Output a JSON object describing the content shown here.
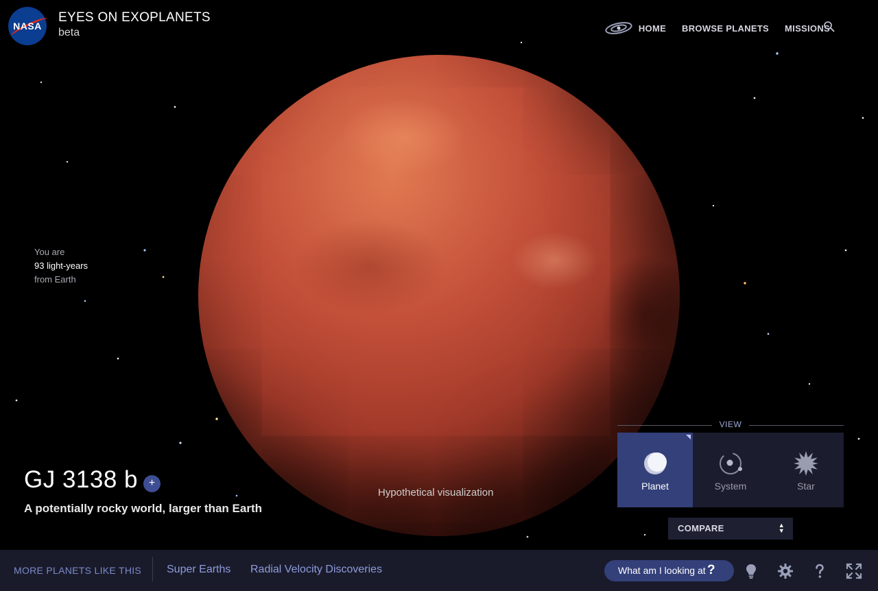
{
  "header": {
    "logo_text": "NASA",
    "title": "EYES ON EXOPLANETS",
    "subtitle": "beta"
  },
  "nav": {
    "home": "HOME",
    "browse": "BROWSE PLANETS",
    "missions": "MISSIONS"
  },
  "distance": {
    "line1": "You are",
    "line2": "93 light-years",
    "line3": "from Earth"
  },
  "planet": {
    "name": "GJ 3138 b",
    "add_symbol": "+",
    "tagline": "A potentially rocky world, larger than Earth",
    "caption": "Hypothetical visualization"
  },
  "view": {
    "label": "VIEW",
    "options": [
      {
        "label": "Planet",
        "icon": "planet-icon",
        "active": true
      },
      {
        "label": "System",
        "icon": "system-icon",
        "active": false
      },
      {
        "label": "Star",
        "icon": "star-icon",
        "active": false
      }
    ]
  },
  "compare": {
    "label": "COMPARE",
    "arrows": "▲▼"
  },
  "bottom_bar": {
    "more_label": "MORE PLANETS LIKE THIS",
    "links": [
      "Super Earths",
      "Radial Velocity Discoveries"
    ],
    "what_button": "What am I looking at",
    "what_symbol": "?"
  },
  "colors": {
    "accent": "#34407a",
    "link": "#8f9cdb",
    "bar_bg": "#191b2b"
  }
}
